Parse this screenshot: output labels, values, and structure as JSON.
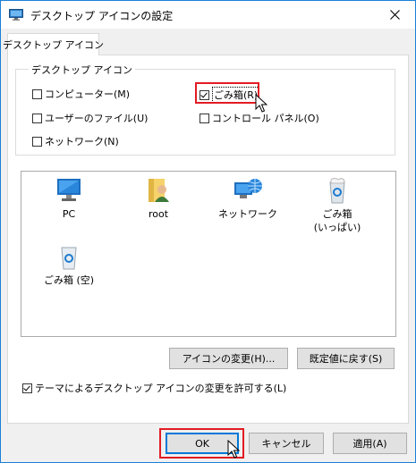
{
  "window": {
    "title": "デスクトップ アイコンの設定"
  },
  "tab": {
    "label": "デスクトップ アイコン"
  },
  "group": {
    "legend": "デスクトップ アイコン",
    "checkboxes": [
      {
        "label": "コンピューター(M)",
        "checked": false
      },
      {
        "label": "ユーザーのファイル(U)",
        "checked": false
      },
      {
        "label": "ネットワーク(N)",
        "checked": false
      },
      {
        "label": "ごみ箱(R)",
        "checked": true
      },
      {
        "label": "コントロール パネル(O)",
        "checked": false
      }
    ]
  },
  "icons": [
    {
      "label": "PC",
      "icon": "pc-icon"
    },
    {
      "label": "root",
      "icon": "user-folder-icon"
    },
    {
      "label": "ネットワーク",
      "icon": "network-icon"
    },
    {
      "label": "ごみ箱\n(いっぱい)",
      "icon": "recycle-bin-full-icon"
    },
    {
      "label": "ごみ箱 (空)",
      "icon": "recycle-bin-empty-icon"
    }
  ],
  "buttons": {
    "change_icon": "アイコンの変更(H)...",
    "restore_default": "既定値に戻す(S)",
    "ok": "OK",
    "cancel": "キャンセル",
    "apply": "適用(A)"
  },
  "theme_option": {
    "label": "テーマによるデスクトップ アイコンの変更を許可する(L)",
    "checked": true
  },
  "colors": {
    "accent": "#0078d7",
    "highlight": "#e21b23"
  }
}
